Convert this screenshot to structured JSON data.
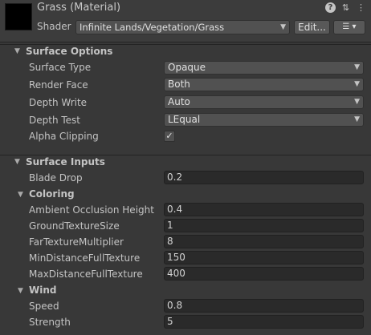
{
  "header": {
    "title": "Grass (Material)",
    "shader_label": "Shader",
    "shader_value": "Infinite Lands/Vegetation/Grass",
    "edit_label": "Edit...",
    "icons": [
      "help-icon",
      "preset-icon",
      "context-menu-icon"
    ]
  },
  "surface_options": {
    "title": "Surface Options",
    "surface_type": {
      "label": "Surface Type",
      "value": "Opaque"
    },
    "render_face": {
      "label": "Render Face",
      "value": "Both"
    },
    "depth_write": {
      "label": "Depth Write",
      "value": "Auto"
    },
    "depth_test": {
      "label": "Depth Test",
      "value": "LEqual"
    },
    "alpha_clipping": {
      "label": "Alpha Clipping",
      "checked": true
    }
  },
  "surface_inputs": {
    "title": "Surface Inputs",
    "blade_drop": {
      "label": "Blade Drop",
      "value": "0.2"
    },
    "coloring": {
      "title": "Coloring",
      "ao_height": {
        "label": "Ambient Occlusion Height",
        "value": "0.4"
      },
      "ground_texture_size": {
        "label": "GroundTextureSize",
        "value": "1"
      },
      "far_texture_multiplier": {
        "label": "FarTextureMultiplier",
        "value": "8"
      },
      "min_distance": {
        "label": "MinDistanceFullTexture",
        "value": "150"
      },
      "max_distance": {
        "label": "MaxDistanceFullTexture",
        "value": "400"
      }
    },
    "wind": {
      "title": "Wind",
      "speed": {
        "label": "Speed",
        "value": "0.8"
      },
      "strength": {
        "label": "Strength",
        "value": "5"
      }
    }
  }
}
